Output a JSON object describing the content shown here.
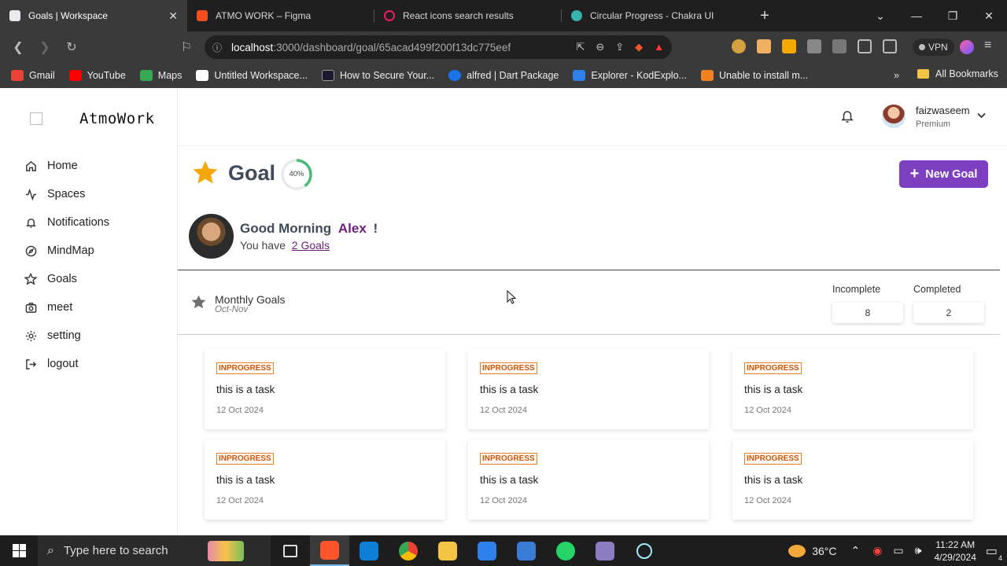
{
  "browser": {
    "tabs": [
      {
        "title": "Goals | Workspace",
        "favicon_color": "#e8eaed",
        "active": true
      },
      {
        "title": "ATMO WORK – Figma",
        "favicon_color": "#f24e1e",
        "active": false
      },
      {
        "title": "React icons search results",
        "favicon_color": "#e91e63",
        "active": false
      },
      {
        "title": "Circular Progress - Chakra UI",
        "favicon_color": "#38b2ac",
        "active": false
      }
    ],
    "url_host": "localhost",
    "url_rest": ":3000/dashboard/goal/65acad499f200f13dc775eef",
    "vpn_label": "VPN",
    "bookmarks": [
      {
        "label": "Gmail",
        "color": "#ea4335"
      },
      {
        "label": "YouTube",
        "color": "#ff0000"
      },
      {
        "label": "Maps",
        "color": "#34a853"
      },
      {
        "label": "Untitled Workspace...",
        "color": "#ffffff"
      },
      {
        "label": "How to Secure Your...",
        "color": "#1a1a2e"
      },
      {
        "label": "alfred | Dart Package",
        "color": "#1a73e8"
      },
      {
        "label": "Explorer - KodExplo...",
        "color": "#2f80ed"
      },
      {
        "label": "Unable to install m...",
        "color": "#f48024"
      }
    ],
    "bookmarks_more": "»",
    "all_bookmarks": "All Bookmarks"
  },
  "app": {
    "brand": "AtmoWork",
    "nav": [
      {
        "label": "Home",
        "icon": "home-icon"
      },
      {
        "label": "Spaces",
        "icon": "activity-icon"
      },
      {
        "label": "Notifications",
        "icon": "bell-icon"
      },
      {
        "label": "MindMap",
        "icon": "compass-icon"
      },
      {
        "label": "Goals",
        "icon": "star-icon"
      },
      {
        "label": "meet",
        "icon": "camera-icon"
      },
      {
        "label": "setting",
        "icon": "gear-icon"
      },
      {
        "label": "logout",
        "icon": "logout-icon"
      }
    ],
    "user": {
      "name": "faizwaseem",
      "tier": "Premium"
    },
    "page_title": "Goal",
    "progress_percent": 40,
    "progress_label": "40%",
    "new_goal_label": "New Goal",
    "greeting": {
      "prefix": "Good Morning",
      "name": "Alex",
      "suffix": "!",
      "sub_prefix": "You have",
      "goals_link": "2 Goals"
    },
    "monthly": {
      "title": "Monthly Goals",
      "period": "Oct-Nov"
    },
    "stats": {
      "incomplete_label": "Incomplete",
      "incomplete_value": "8",
      "completed_label": "Completed",
      "completed_value": "2"
    },
    "tasks": [
      {
        "status": "INPROGRESS",
        "title": "this is a task",
        "date": "12 Oct 2024"
      },
      {
        "status": "INPROGRESS",
        "title": "this is a task",
        "date": "12 Oct 2024"
      },
      {
        "status": "INPROGRESS",
        "title": "this is a task",
        "date": "12 Oct 2024"
      },
      {
        "status": "INPROGRESS",
        "title": "this is a task",
        "date": "12 Oct 2024"
      },
      {
        "status": "INPROGRESS",
        "title": "this is a task",
        "date": "12 Oct 2024"
      },
      {
        "status": "INPROGRESS",
        "title": "this is a task",
        "date": "12 Oct 2024"
      }
    ],
    "accent_color": "#7b3fbf",
    "badge_color": "#e67e22"
  },
  "taskbar": {
    "search_placeholder": "Type here to search",
    "temperature": "36°C",
    "time": "11:22 AM",
    "date": "4/29/2024",
    "notification_count": "4"
  }
}
